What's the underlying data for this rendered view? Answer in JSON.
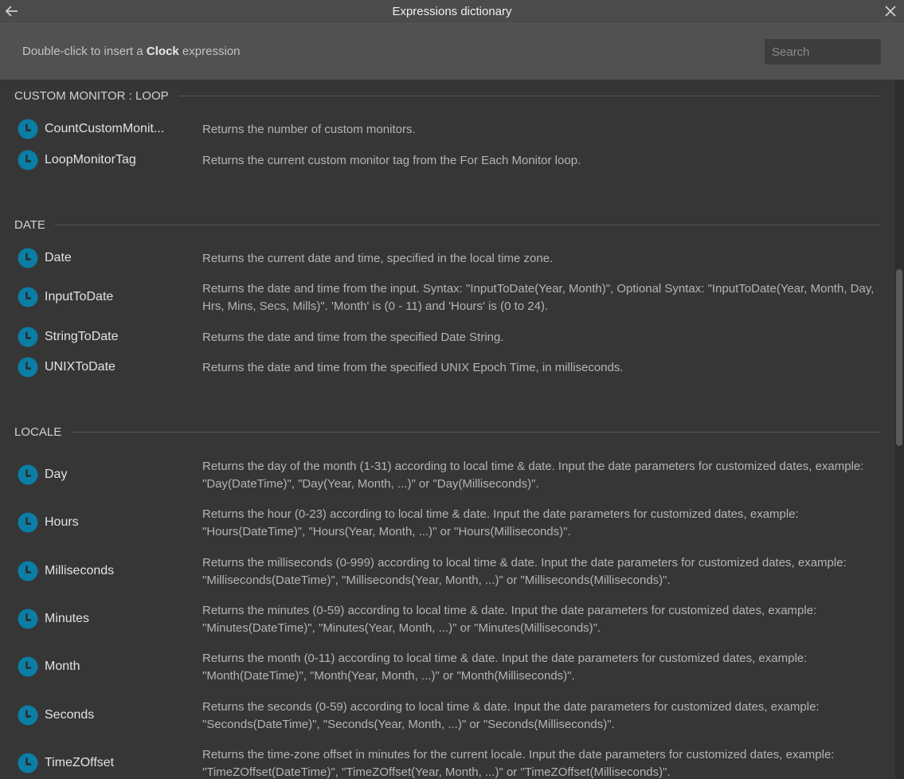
{
  "window": {
    "title": "Expressions dictionary",
    "hint_prefix": "Double-click to insert a ",
    "hint_bold": "Clock",
    "hint_suffix": " expression",
    "search_placeholder": "Search"
  },
  "colors": {
    "accent": "#0b7ea5",
    "background": "#363636",
    "header": "#515151"
  },
  "icons": {
    "item": "clock-icon",
    "back": "arrow-left-icon",
    "close": "close-icon"
  },
  "sections": [
    {
      "title": "CUSTOM MONITOR : LOOP",
      "items": [
        {
          "name": "CountCustomMonit...",
          "desc": "Returns the number of custom monitors."
        },
        {
          "name": "LoopMonitorTag",
          "desc": "Returns the current custom monitor tag from the For Each Monitor loop."
        }
      ]
    },
    {
      "title": "DATE",
      "items": [
        {
          "name": "Date",
          "desc": "Returns the current date and time, specified in the local time zone."
        },
        {
          "name": "InputToDate",
          "desc": "Returns the date and time from the input. Syntax: \"InputToDate(Year, Month)\", Optional Syntax: \"InputToDate(Year, Month, Day, Hrs, Mins, Secs, Mills)\". 'Month' is (0 - 11) and 'Hours' is (0 to 24)."
        },
        {
          "name": "StringToDate",
          "desc": "Returns the date and time from the specified Date String."
        },
        {
          "name": "UNIXToDate",
          "desc": "Returns the date and time from the specified UNIX Epoch Time, in milliseconds."
        }
      ]
    },
    {
      "title": "LOCALE",
      "items": [
        {
          "name": "Day",
          "desc": "Returns the day of the month (1-31) according to local time & date. Input the date parameters for customized dates, example: \"Day(DateTime)\", \"Day(Year, Month, ...)\" or \"Day(Milliseconds)\"."
        },
        {
          "name": "Hours",
          "desc": "Returns the hour (0-23) according to local time & date. Input the date parameters for customized dates, example: \"Hours(DateTime)\", \"Hours(Year, Month, ...)\" or \"Hours(Milliseconds)\"."
        },
        {
          "name": "Milliseconds",
          "desc": "Returns the milliseconds (0-999) according to local time & date. Input the date parameters for customized dates, example: \"Milliseconds(DateTime)\", \"Milliseconds(Year, Month, ...)\" or \"Milliseconds(Milliseconds)\"."
        },
        {
          "name": "Minutes",
          "desc": "Returns the minutes (0-59) according to local time & date. Input the date parameters for customized dates, example: \"Minutes(DateTime)\", \"Minutes(Year, Month, ...)\" or \"Minutes(Milliseconds)\"."
        },
        {
          "name": "Month",
          "desc": "Returns the month (0-11) according to local time & date. Input the date parameters for customized dates, example: \"Month(DateTime)\", \"Month(Year, Month, ...)\" or \"Month(Milliseconds)\"."
        },
        {
          "name": "Seconds",
          "desc": "Returns the seconds (0-59) according to local time & date. Input the date parameters for customized dates, example: \"Seconds(DateTime)\", \"Seconds(Year, Month, ...)\" or \"Seconds(Milliseconds)\"."
        },
        {
          "name": "TimeZOffset",
          "desc": "Returns the time-zone offset in minutes for the current locale. Input the date parameters for customized dates, example: \"TimeZOffset(DateTime)\", \"TimeZOffset(Year, Month, ...)\" or \"TimeZOffset(Milliseconds)\"."
        }
      ]
    }
  ]
}
